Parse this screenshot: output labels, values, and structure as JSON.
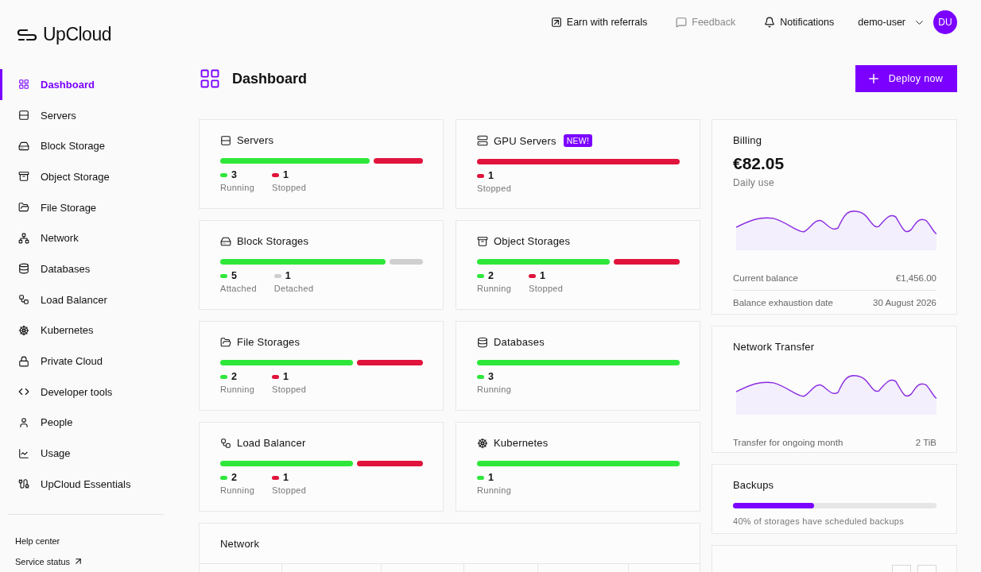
{
  "brand": {
    "name": "UpCloud"
  },
  "sidebar": {
    "items": [
      {
        "label": "Dashboard",
        "selected": true
      },
      {
        "label": "Servers",
        "selected": false
      },
      {
        "label": "Block Storage",
        "selected": false
      },
      {
        "label": "Object Storage",
        "selected": false
      },
      {
        "label": "File Storage",
        "selected": false
      },
      {
        "label": "Network",
        "selected": false
      },
      {
        "label": "Databases",
        "selected": false
      },
      {
        "label": "Load Balancer",
        "selected": false
      },
      {
        "label": "Kubernetes",
        "selected": false
      },
      {
        "label": "Private Cloud",
        "selected": false
      },
      {
        "label": "Developer tools",
        "selected": false
      },
      {
        "label": "People",
        "selected": false
      },
      {
        "label": "Usage",
        "selected": false
      },
      {
        "label": "UpCloud Essentials",
        "selected": false
      }
    ],
    "footer_links": [
      "Help center",
      "Service status"
    ]
  },
  "topbar": {
    "items": [
      {
        "label": "Earn with referrals",
        "disabled": false
      },
      {
        "label": "Feedback",
        "disabled": true
      },
      {
        "label": "Notifications",
        "disabled": false
      }
    ],
    "user": "demo-user",
    "avatar": "DU"
  },
  "page": {
    "title": "Dashboard",
    "action": "Deploy now"
  },
  "resources": [
    {
      "title": "Servers",
      "segments": [
        {
          "count": "3",
          "label": "Running",
          "kind": "running"
        },
        {
          "count": "1",
          "label": "Stopped",
          "kind": "stopped"
        }
      ]
    },
    {
      "title": "GPU Servers",
      "badge": "NEW!",
      "segments": [
        {
          "count": "1",
          "label": "Stopped",
          "kind": "stopped"
        }
      ]
    },
    {
      "title": "Block Storages",
      "segments": [
        {
          "count": "5",
          "label": "Attached",
          "kind": "running"
        },
        {
          "count": "1",
          "label": "Detached",
          "kind": "detached"
        }
      ]
    },
    {
      "title": "Object Storages",
      "segments": [
        {
          "count": "2",
          "label": "Running",
          "kind": "running"
        },
        {
          "count": "1",
          "label": "Stopped",
          "kind": "stopped"
        }
      ]
    },
    {
      "title": "File Storages",
      "segments": [
        {
          "count": "2",
          "label": "Running",
          "kind": "running"
        },
        {
          "count": "1",
          "label": "Stopped",
          "kind": "stopped"
        }
      ]
    },
    {
      "title": "Databases",
      "segments": [
        {
          "count": "3",
          "label": "Running",
          "kind": "running"
        }
      ]
    },
    {
      "title": "Load Balancer",
      "segments": [
        {
          "count": "2",
          "label": "Running",
          "kind": "running"
        },
        {
          "count": "1",
          "label": "Stopped",
          "kind": "stopped"
        }
      ]
    },
    {
      "title": "Kubernetes",
      "segments": [
        {
          "count": "1",
          "label": "Running",
          "kind": "running"
        }
      ]
    }
  ],
  "network": {
    "title": "Network"
  },
  "billing": {
    "title": "Billing",
    "amount": "€82.05",
    "caption": "Daily use",
    "rows": [
      {
        "label": "Current balance",
        "value": "€1,456.00"
      },
      {
        "label": "Balance exhaustion date",
        "value": "30 August 2026"
      }
    ]
  },
  "network_transfer": {
    "title": "Network Transfer",
    "rows": [
      {
        "label": "Transfer for ongoing month",
        "value": "2 TiB"
      }
    ]
  },
  "backups": {
    "title": "Backups",
    "level": 0.4,
    "caption": "40% of storages have scheduled backups"
  }
}
